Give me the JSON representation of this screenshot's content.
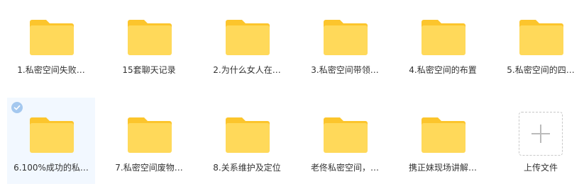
{
  "colors": {
    "folder_back": "#fcc52c",
    "folder_front": "#ffd95a",
    "selected_bg": "#f2f8ff",
    "check": "#a4c8ef"
  },
  "folders": [
    {
      "label": "1.私密空间失败…",
      "icon": "folder-icon",
      "selected": false
    },
    {
      "label": "15套聊天记录",
      "icon": "folder-icon",
      "selected": false
    },
    {
      "label": "2.为什么女人在…",
      "icon": "folder-icon",
      "selected": false
    },
    {
      "label": "3.私密空间带领…",
      "icon": "folder-icon",
      "selected": false
    },
    {
      "label": "4.私密空间的布置",
      "icon": "folder-icon",
      "selected": false
    },
    {
      "label": "5.私密空间的四…",
      "icon": "folder-icon",
      "selected": false
    },
    {
      "label": "6.100%成功的私…",
      "icon": "folder-icon",
      "selected": true
    },
    {
      "label": "7.私密空间废物…",
      "icon": "folder-icon",
      "selected": false
    },
    {
      "label": "8.关系维护及定位",
      "icon": "folder-icon",
      "selected": false
    },
    {
      "label": "老佟私密空间，…",
      "icon": "folder-icon",
      "selected": false
    },
    {
      "label": "携正妹现场讲解…",
      "icon": "folder-icon",
      "selected": false
    }
  ],
  "upload": {
    "label": "上传文件",
    "icon": "plus-icon"
  }
}
